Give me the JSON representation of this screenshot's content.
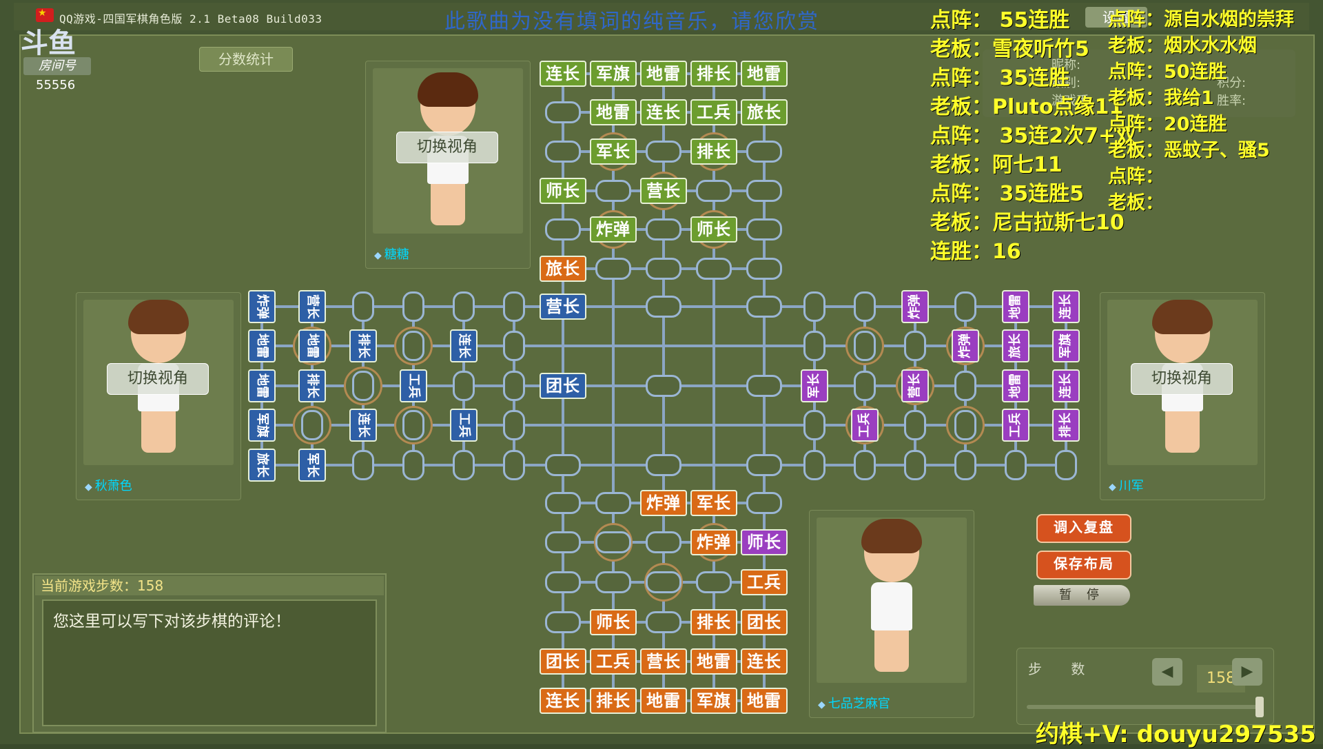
{
  "window": {
    "title": "QQ游戏-四国军棋角色版 2.1 Beta08 Build033",
    "music_banner": "此歌曲为没有填词的纯音乐，请您欣赏",
    "settings_label": "设置"
  },
  "room": {
    "label": "房间号",
    "number": "55556",
    "score_button": "分数统计"
  },
  "players": {
    "top": {
      "name": "糖糖",
      "switch": "切换视角"
    },
    "left": {
      "name": "秋萧色",
      "switch": "切换视角"
    },
    "right": {
      "name": "川军",
      "switch": "切换视角"
    },
    "bottom": {
      "name": "七品芝麻官"
    }
  },
  "info_labels": [
    "昵称:",
    "级别:",
    "游戏币:",
    "积分:",
    "胜率:"
  ],
  "overlay_left": [
    "点阵： 55连胜",
    "老板：雪夜听竹5",
    "点阵： 35连胜",
    "老板：Pluto点缘11",
    "点阵： 35连2次7+双",
    "老板：阿七11",
    "点阵： 35连胜5",
    "老板：尼古拉斯七10",
    "连胜：16"
  ],
  "overlay_right": [
    "点阵：源自水烟的崇拜",
    "老板：烟水水水烟",
    "点阵：50连胜",
    "老板：我给1",
    "点阵：20连胜",
    "老板：恶蚊子、骚5",
    "点阵：",
    "老板："
  ],
  "board": {
    "top_green": [
      [
        "连长",
        "军旗",
        "地雷",
        "排长",
        "地雷"
      ],
      [
        null,
        "地雷",
        "连长",
        "工兵",
        "旅长"
      ],
      [
        null,
        "军长",
        null,
        "排长",
        null
      ],
      [
        "师长",
        null,
        "营长",
        null,
        null
      ],
      [
        null,
        "炸弹",
        null,
        "师长",
        null
      ]
    ],
    "top_orange_single": "旅长",
    "center_pieces": [
      "营长",
      "团长"
    ],
    "bottom_orange": [
      [
        null,
        null,
        "炸弹",
        "军长",
        null
      ],
      [
        null,
        null,
        null,
        "炸弹",
        null
      ],
      [
        null,
        null,
        null,
        null,
        "工兵"
      ],
      [
        null,
        "师长",
        null,
        "排长",
        "团长"
      ],
      [
        "团长",
        "工兵",
        "营长",
        "地雷",
        "连长"
      ],
      [
        "连长",
        "排长",
        "地雷",
        "军旗",
        "地雷"
      ]
    ],
    "bottom_purple": "师长",
    "left_blue": [
      [
        "炸弹",
        "营长",
        null,
        null,
        null,
        null
      ],
      [
        "地雷",
        "地雷",
        "排长",
        null,
        "连长",
        null
      ],
      [
        "地雷",
        "排长",
        null,
        "工兵",
        null,
        null
      ],
      [
        "军旗",
        null,
        "连长",
        null,
        "工兵",
        null
      ],
      [
        "旅长",
        "军长",
        null,
        null,
        null,
        null
      ]
    ],
    "right_purple": [
      [
        null,
        null,
        "炸弹",
        null,
        "地雷",
        "连长"
      ],
      [
        null,
        null,
        null,
        "炸弹",
        "旅长",
        "军旗"
      ],
      [
        "军长",
        null,
        "营长",
        null,
        "地雷",
        "连长"
      ],
      [
        null,
        "工兵",
        null,
        null,
        "工兵",
        "排长"
      ],
      [
        null,
        null,
        null,
        null,
        null,
        null
      ]
    ]
  },
  "comment": {
    "header": "当前游戏步数：158",
    "text": "您这里可以写下对该步棋的评论！"
  },
  "actions": {
    "load_replay": "调入复盘",
    "save_layout": "保存布局",
    "pause": "暂 停"
  },
  "steps": {
    "label": "步 数",
    "value": "158",
    "prev": "◀",
    "next": "▶",
    "progress": 1.0
  },
  "footer": "约棋+V: douyu297535"
}
